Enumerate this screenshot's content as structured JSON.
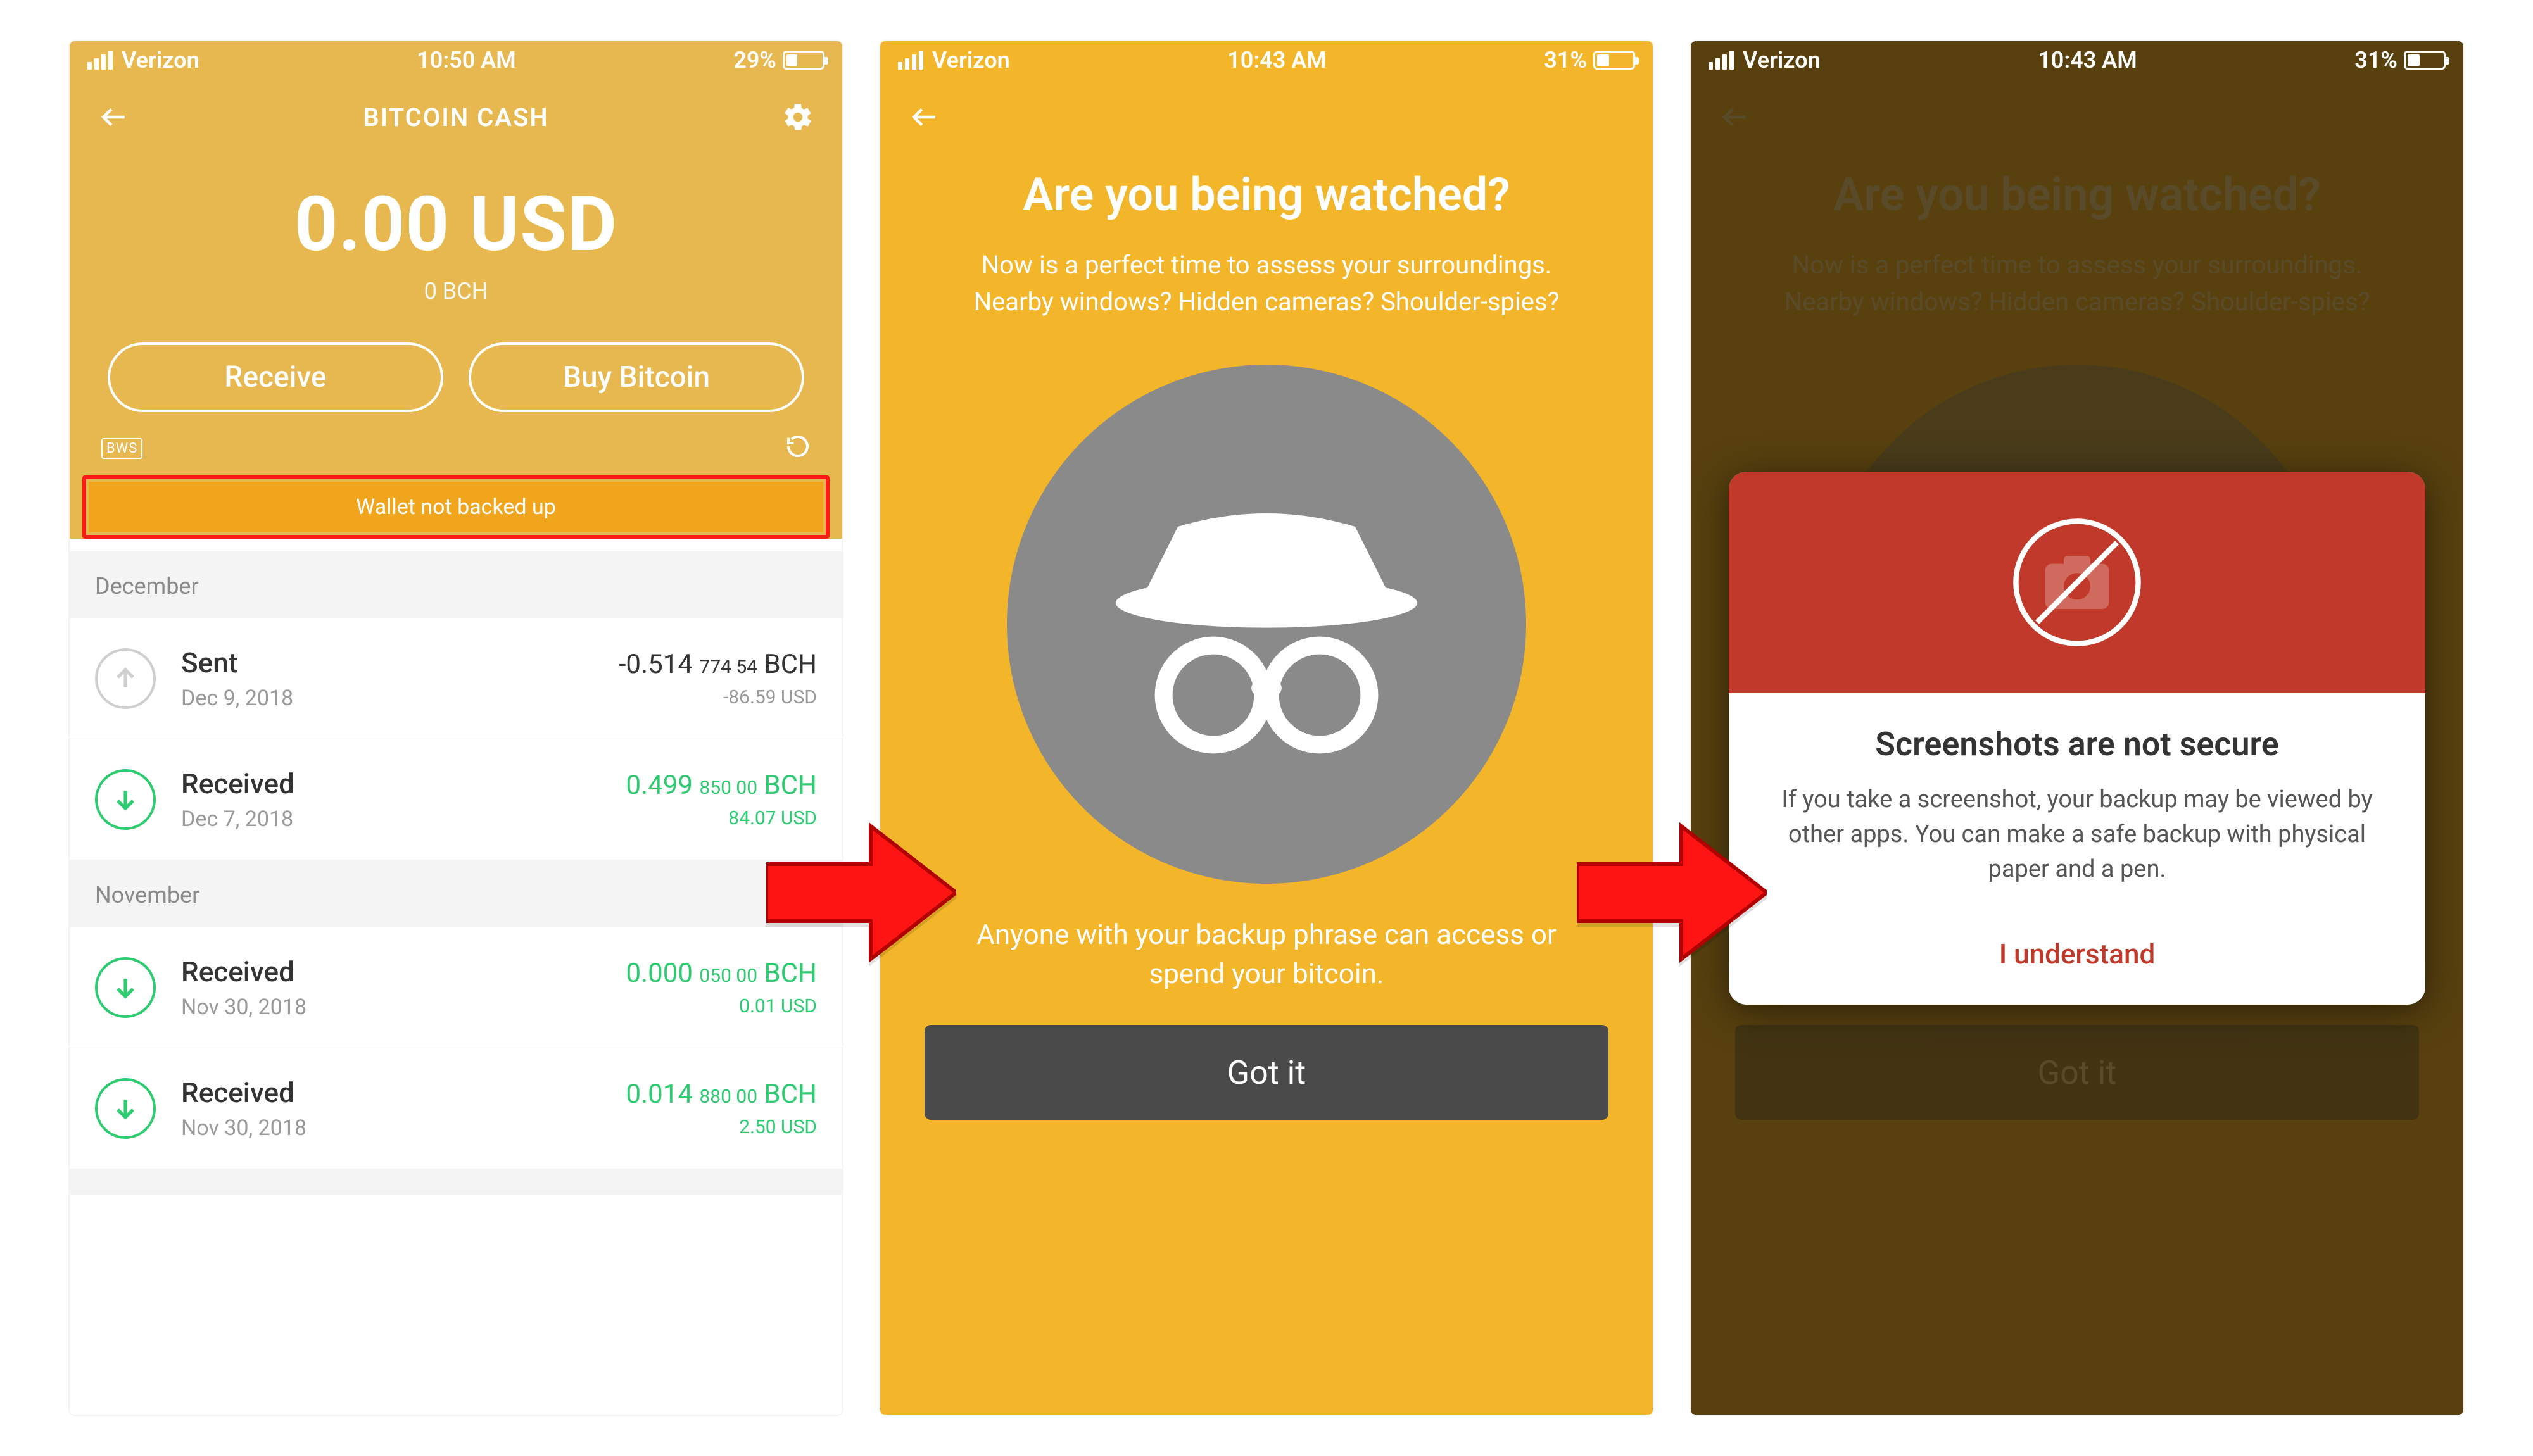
{
  "status": {
    "carrier": "Verizon",
    "time1": "10:50 AM",
    "time2": "10:43 AM",
    "time3": "10:43 AM",
    "battery1": "29%",
    "battery2": "31%",
    "battery3": "31%"
  },
  "screen1": {
    "title": "BITCOIN CASH",
    "balance_fiat": "0.00 USD",
    "balance_crypto": "0 BCH",
    "receive": "Receive",
    "buy": "Buy Bitcoin",
    "bws": "BWS",
    "warn": "Wallet not backed up",
    "month1": "December",
    "month2": "November",
    "tx": [
      {
        "type": "Sent",
        "date": "Dec 9, 2018",
        "amt_main": "-0.514",
        "amt_sub": "774 54",
        "amt_sym": "BCH",
        "usd": "-86.59 USD",
        "green": false
      },
      {
        "type": "Received",
        "date": "Dec 7, 2018",
        "amt_main": "0.499",
        "amt_sub": "850 00",
        "amt_sym": "BCH",
        "usd": "84.07 USD",
        "green": true
      },
      {
        "type": "Received",
        "date": "Nov 30, 2018",
        "amt_main": "0.000",
        "amt_sub": "050 00",
        "amt_sym": "BCH",
        "usd": "0.01 USD",
        "green": true
      },
      {
        "type": "Received",
        "date": "Nov 30, 2018",
        "amt_main": "0.014",
        "amt_sub": "880 00",
        "amt_sym": "BCH",
        "usd": "2.50 USD",
        "green": true
      }
    ]
  },
  "screen2": {
    "heading": "Are you being watched?",
    "body": "Now is a perfect time to assess your surroundings. Nearby windows? Hidden cameras? Shoulder-spies?",
    "foot": "Anyone with your backup phrase can access or spend your bitcoin.",
    "got_it": "Got it"
  },
  "screen3": {
    "modal_title": "Screenshots are not secure",
    "modal_body": "If you take a screenshot, your backup may be viewed by other apps. You can make a safe backup with physical paper and a pen.",
    "modal_action": "I understand"
  }
}
